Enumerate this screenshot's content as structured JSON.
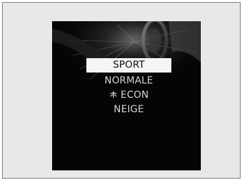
{
  "display": {
    "modes": [
      {
        "label": "SPORT",
        "selected": true,
        "icon": null
      },
      {
        "label": "NORMALE",
        "selected": false,
        "icon": null
      },
      {
        "label": "ECON",
        "selected": false,
        "icon": "eco-leaf-icon"
      },
      {
        "label": "NEIGE",
        "selected": false,
        "icon": null
      }
    ]
  },
  "colors": {
    "screen_background": "#050505",
    "selected_highlight": "#f5f5f5",
    "text": "#d6d6d6",
    "frame_border": "#7a7a7a",
    "frame_background": "#e8e8e8"
  }
}
